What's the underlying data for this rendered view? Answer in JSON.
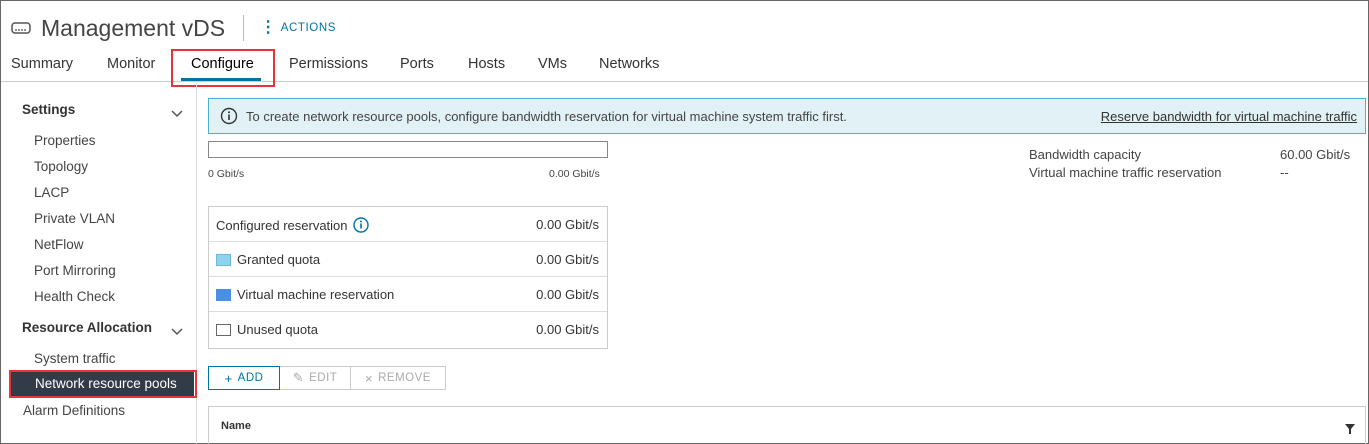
{
  "header": {
    "title": "Management vDS",
    "actions_label": "ACTIONS",
    "icon": "vds-switch-icon"
  },
  "tabs": [
    {
      "label": "Summary"
    },
    {
      "label": "Monitor"
    },
    {
      "label": "Configure",
      "active": true
    },
    {
      "label": "Permissions"
    },
    {
      "label": "Ports"
    },
    {
      "label": "Hosts"
    },
    {
      "label": "VMs"
    },
    {
      "label": "Networks"
    }
  ],
  "sidebar": {
    "settings_label": "Settings",
    "settings_items": [
      "Properties",
      "Topology",
      "LACP",
      "Private VLAN",
      "NetFlow",
      "Port Mirroring",
      "Health Check"
    ],
    "resource_label": "Resource Allocation",
    "resource_items": [
      "System traffic",
      "Network resource pools"
    ],
    "selected": "Network resource pools",
    "alarm_label": "Alarm Definitions"
  },
  "banner": {
    "message": "To create network resource pools, configure bandwidth reservation for virtual machine system traffic first.",
    "link": "Reserve bandwidth for virtual machine traffic"
  },
  "bandwidth": {
    "min_label": "0 Gbit/s",
    "max_label": "0.00 Gbit/s",
    "capacity_label": "Bandwidth capacity",
    "capacity_value": "60.00 Gbit/s",
    "vm_reservation_label": "Virtual machine traffic reservation",
    "vm_reservation_value": "--"
  },
  "reservation": {
    "configured_label": "Configured reservation",
    "configured_value": "0.00 Gbit/s",
    "granted_label": "Granted quota",
    "granted_value": "0.00 Gbit/s",
    "vm_label": "Virtual machine reservation",
    "vm_value": "0.00 Gbit/s",
    "unused_label": "Unused quota",
    "unused_value": "0.00 Gbit/s"
  },
  "buttons": {
    "add": "ADD",
    "edit": "EDIT",
    "remove": "REMOVE"
  },
  "grid": {
    "col_name": "Name"
  },
  "colors": {
    "accent": "#0072a3",
    "selected_bg": "#313c48",
    "highlight": "#e5353a",
    "granted_swatch": "#8dd3ec",
    "vm_swatch": "#4a90e2",
    "banner_bg": "#e1f1f6"
  }
}
